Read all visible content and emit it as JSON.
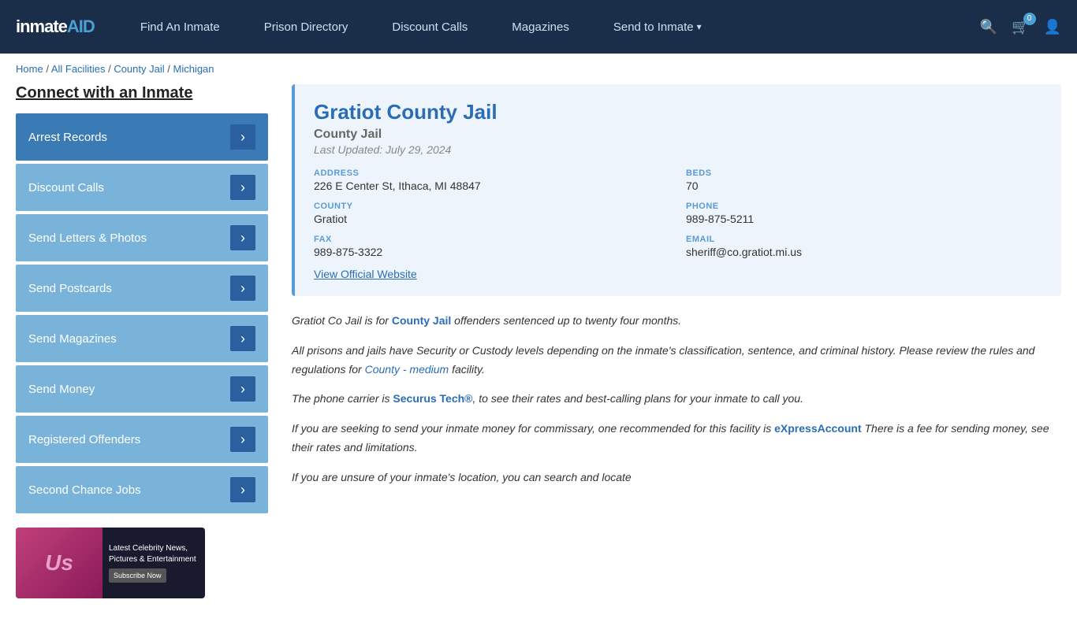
{
  "header": {
    "logo": "inmateAID",
    "nav": [
      {
        "label": "Find An Inmate",
        "id": "find-inmate"
      },
      {
        "label": "Prison Directory",
        "id": "prison-directory"
      },
      {
        "label": "Discount Calls",
        "id": "discount-calls"
      },
      {
        "label": "Magazines",
        "id": "magazines"
      },
      {
        "label": "Send to Inmate",
        "id": "send-to-inmate",
        "has_dropdown": true
      }
    ],
    "cart_count": "0",
    "icons": {
      "search": "🔍",
      "cart": "🛒",
      "user": "👤"
    }
  },
  "breadcrumb": {
    "items": [
      "Home",
      "All Facilities",
      "County Jail",
      "Michigan"
    ],
    "separator": "/"
  },
  "sidebar": {
    "title": "Connect with an Inmate",
    "menu": [
      {
        "label": "Arrest Records",
        "active": true
      },
      {
        "label": "Discount Calls"
      },
      {
        "label": "Send Letters & Photos"
      },
      {
        "label": "Send Postcards"
      },
      {
        "label": "Send Magazines"
      },
      {
        "label": "Send Money"
      },
      {
        "label": "Registered Offenders"
      },
      {
        "label": "Second Chance Jobs"
      }
    ],
    "ad": {
      "brand": "Us",
      "tagline": "Latest Celebrity News, Pictures & Entertainment",
      "cta": "Subscribe Now"
    }
  },
  "facility": {
    "name": "Gratiot County Jail",
    "type": "County Jail",
    "last_updated": "Last Updated: July 29, 2024",
    "address_label": "ADDRESS",
    "address": "226 E Center St, Ithaca, MI 48847",
    "beds_label": "BEDS",
    "beds": "70",
    "county_label": "COUNTY",
    "county": "Gratiot",
    "phone_label": "PHONE",
    "phone": "989-875-5211",
    "fax_label": "FAX",
    "fax": "989-875-3322",
    "email_label": "EMAIL",
    "email": "sheriff@co.gratiot.mi.us",
    "website_link": "View Official Website"
  },
  "description": {
    "p1_pre": "Gratiot Co Jail is for ",
    "p1_bold": "County Jail",
    "p1_post": " offenders sentenced up to twenty four months.",
    "p2": "All prisons and jails have Security or Custody levels depending on the inmate's classification, sentence, and criminal history. Please review the rules and regulations for ",
    "p2_link": "County - medium",
    "p2_post": " facility.",
    "p3_pre": "The phone carrier is ",
    "p3_link": "Securus Tech®",
    "p3_post": ", to see their rates and best-calling plans for your inmate to call you.",
    "p4_pre": "If you are seeking to send your inmate money for commissary, one recommended for this facility is ",
    "p4_link": "eXpressAccount",
    "p4_post": " There is a fee for sending money, see their rates and limitations.",
    "p5": "If you are unsure of your inmate's location, you can search and locate"
  }
}
